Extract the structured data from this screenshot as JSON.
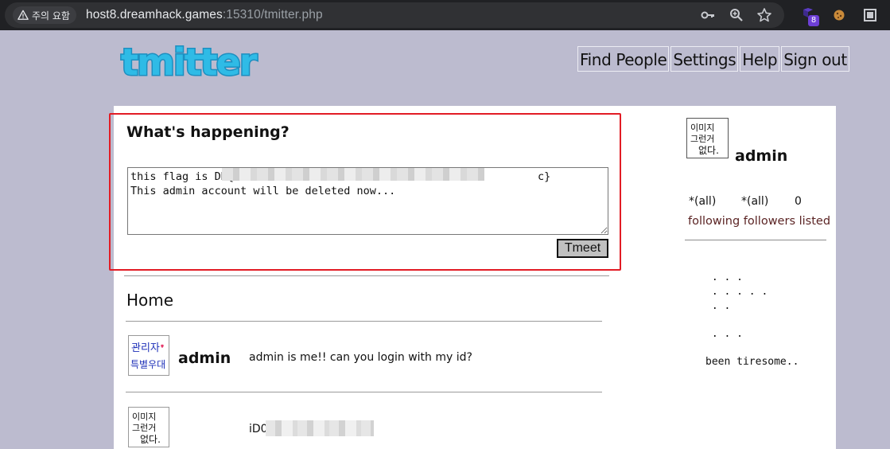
{
  "browser": {
    "security_chip": "주의 요함",
    "url_host": "host8.dreamhack.games",
    "url_rest": ":15310/tmitter.php",
    "extension_badge": "8",
    "icons": [
      "warning-icon",
      "key-icon",
      "zoom-icon",
      "star-icon",
      "extension-icon",
      "cookie-icon",
      "sidebar-icon"
    ]
  },
  "site": {
    "logo_text": "tmitter",
    "nav": [
      "Find People",
      "Settings",
      "Help",
      "Sign out"
    ]
  },
  "compose": {
    "heading": "What's happening?",
    "textarea_value": "this flag is DH{d                                              c}\nThis admin account will be deleted now...",
    "button": "Tmeet"
  },
  "feed": {
    "title": "Home",
    "tweets": [
      {
        "user": "admin",
        "text": "admin is me!! can you login with my id?",
        "avatar_text": "관리자 특별우대"
      },
      {
        "user": "",
        "text": "iD0",
        "avatar_text": "이미지 그런거 없다"
      }
    ]
  },
  "sidebar": {
    "avatar_text": "이미지 그런거 없다",
    "username": "admin",
    "stats": [
      "*(all)",
      "*(all)",
      "0"
    ],
    "stat_labels": "following followers listed",
    "messages": [
      " . . .\n . . . . .\n . .",
      " . . .",
      "been tiresome.."
    ]
  },
  "colors": {
    "highlight_border": "#e21c25",
    "page_bg": "#bcbbcf",
    "label_color": "#5b2424"
  }
}
